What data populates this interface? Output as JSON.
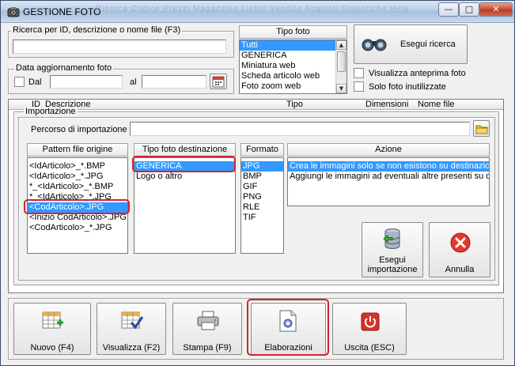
{
  "window": {
    "title": "GESTIONE FOTO",
    "ghost_menu": "Ricerca  Codice  Prezzi  Magazzino  Listini  Vendite  Acquisti  Statistiche  Help",
    "min_label": "—",
    "max_label": "□",
    "close_label": "✕"
  },
  "search": {
    "group_label": "Ricerca per ID, descrizione o nome file (F3)",
    "value": "",
    "button_label": "Esegui ricerca"
  },
  "date_filter": {
    "group_label": "Data aggiornamento foto",
    "from_label": "Dal",
    "to_label": "al",
    "from_value": "",
    "to_value": ""
  },
  "photo_type": {
    "header": "Tipo foto",
    "items": [
      "Tutti",
      "GENERICA",
      "Miniatura web",
      "Scheda articolo web",
      "Foto zoom web"
    ],
    "selected_index": 0
  },
  "options": {
    "preview_label": "Visualizza anteprima foto",
    "unused_label": "Solo foto inutilizzate"
  },
  "table": {
    "columns": [
      "ID",
      "Descrizione",
      "Tipo",
      "Dimensioni",
      "Nome file"
    ]
  },
  "import": {
    "group_label": "Importazione",
    "path_label": "Percorso di importazione :",
    "path_value": "",
    "patterns": {
      "header": "Pattern file origine",
      "items": [
        "<IdArticolo>_*.BMP",
        "<IdArticolo>_*.JPG",
        "*_<IdArticolo>_*.BMP",
        "*_<IdArticolo>_*.JPG",
        "<CodArticolo>.JPG",
        "<Inizio CodArticolo>.JPG",
        "<CodArticolo>_*.JPG"
      ],
      "selected_index": 4
    },
    "dest_type": {
      "header": "Tipo foto destinazione",
      "items": [
        "GENERICA",
        "Logo o altro"
      ],
      "selected_index": 0
    },
    "format": {
      "header": "Formato",
      "items": [
        "JPG",
        "BMP",
        "GIF",
        "PNG",
        "RLE",
        "TIF"
      ],
      "selected_index": 0
    },
    "action": {
      "header": "Azione",
      "items": [
        "Crea le immagini solo se non esistono su destinazione",
        "Aggiungi le immagini ad eventuali altre presenti su des"
      ],
      "selected_index": 0
    },
    "run_button": "Esegui importazione",
    "run_line1": "Esegui",
    "run_line2": "importazione",
    "cancel_button": "Annulla"
  },
  "toolbar": {
    "new_label": "Nuovo (F4)",
    "view_label": "Visualizza (F2)",
    "print_label": "Stampa (F9)",
    "process_label": "Elaborazioni",
    "exit_label": "Uscita (ESC)"
  },
  "colors": {
    "selection": "#3399ff",
    "highlight": "#d3242f",
    "close_button": "#c64a32"
  }
}
